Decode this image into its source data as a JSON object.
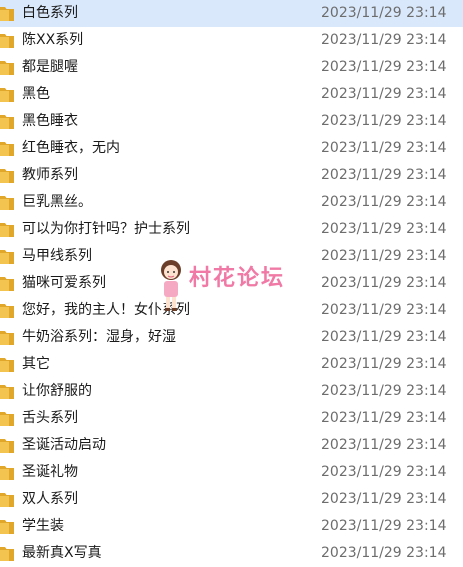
{
  "files": [
    {
      "name": "白色系列",
      "modified": "2023/11/29 23:14",
      "selected": true
    },
    {
      "name": "陈XX系列",
      "modified": "2023/11/29 23:14"
    },
    {
      "name": "都是腿喔",
      "modified": "2023/11/29 23:14"
    },
    {
      "name": "黑色",
      "modified": "2023/11/29 23:14"
    },
    {
      "name": "黑色睡衣",
      "modified": "2023/11/29 23:14"
    },
    {
      "name": "红色睡衣，无内",
      "modified": "2023/11/29 23:14"
    },
    {
      "name": "教师系列",
      "modified": "2023/11/29 23:14"
    },
    {
      "name": "巨乳黑丝。",
      "modified": "2023/11/29 23:14"
    },
    {
      "name": "可以为你打针吗？护士系列",
      "modified": "2023/11/29 23:14"
    },
    {
      "name": "马甲线系列",
      "modified": "2023/11/29 23:14"
    },
    {
      "name": "猫咪可爱系列",
      "modified": "2023/11/29 23:14"
    },
    {
      "name": "您好，我的主人！女仆系列",
      "modified": "2023/11/29 23:14"
    },
    {
      "name": "牛奶浴系列：湿身，好湿",
      "modified": "2023/11/29 23:14"
    },
    {
      "name": "其它",
      "modified": "2023/11/29 23:14"
    },
    {
      "name": "让你舒服的",
      "modified": "2023/11/29 23:14"
    },
    {
      "name": "舌头系列",
      "modified": "2023/11/29 23:14"
    },
    {
      "name": "圣诞活动启动",
      "modified": "2023/11/29 23:14"
    },
    {
      "name": "圣诞礼物",
      "modified": "2023/11/29 23:14"
    },
    {
      "name": "双人系列",
      "modified": "2023/11/29 23:14"
    },
    {
      "name": "学生装",
      "modified": "2023/11/29 23:14"
    },
    {
      "name": "最新真X写真",
      "modified": "2023/11/29 23:14"
    }
  ],
  "watermark": {
    "text": "村花论坛"
  },
  "colors": {
    "folder": "#f3c44f",
    "selected_row": "#d9e8fb",
    "date_text": "#6d6d6d",
    "watermark": "#f07aa5"
  },
  "icons": {
    "file_row": "folder-icon",
    "watermark": "girl-mascot-icon"
  }
}
